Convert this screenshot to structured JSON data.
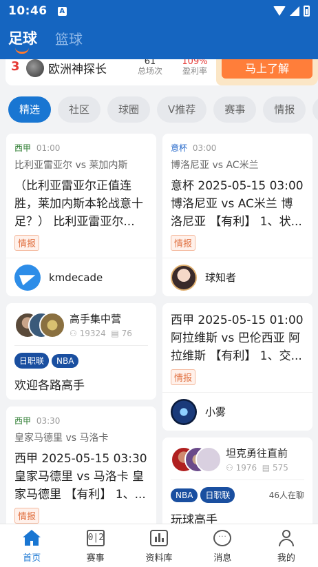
{
  "status": {
    "time": "10:46",
    "notif_glyph": "A"
  },
  "sport_tabs": [
    {
      "label": "足球",
      "active": true
    },
    {
      "label": "篮球",
      "active": false
    }
  ],
  "promo": {
    "rank": "3",
    "name": "欧洲神探长",
    "stats": [
      {
        "value": "61",
        "label": "总场次"
      },
      {
        "value": "109%",
        "label": "盈利率"
      }
    ],
    "button": "马上了解"
  },
  "chips": [
    "精选",
    "社区",
    "球圈",
    "V推荐",
    "赛事",
    "情报",
    "战"
  ],
  "feed_left": [
    {
      "type": "article",
      "league": "西甲",
      "league_color": "#2e7d32",
      "time": "01:00",
      "match": "比利亚雷亚尔 vs 莱加内斯",
      "title": "（比利亚雷亚尔正值连胜，莱加内斯本轮战意十足？） 比利亚雷亚尔...",
      "tag": "情报",
      "author": "kmdecade",
      "avatar_icon": "paper-plane-icon"
    },
    {
      "type": "group",
      "name": "高手集中营",
      "members": "19324",
      "posts": "76",
      "badges": [
        "日职联",
        "NBA"
      ],
      "online": "",
      "title": "欢迎各路高手"
    },
    {
      "type": "article",
      "league": "西甲",
      "league_color": "#2e7d32",
      "time": "03:30",
      "match": "皇家马德里 vs 马洛卡",
      "title": "西甲 2025-05-15 03:30 皇家马德里 vs 马洛卡 皇家马德里 【有利】 1、...",
      "tag": "情报"
    }
  ],
  "feed_right": [
    {
      "type": "article",
      "league": "意杯",
      "league_color": "#1e63c8",
      "time": "03:00",
      "match": "博洛尼亚 vs AC米兰",
      "title": "意杯 2025-05-15 03:00 博洛尼亚 vs AC米兰 博洛尼亚 【有利】 1、状...",
      "tag": "情报",
      "author": "球知者",
      "avatar_icon": "cartoon-avatar-icon"
    },
    {
      "type": "article_nometa",
      "title": "西甲 2025-05-15 01:00 阿拉维斯 vs 巴伦西亚 阿拉维斯 【有利】 1、交...",
      "tag": "情报",
      "author": "小雾",
      "avatar_icon": "car-avatar-icon"
    },
    {
      "type": "group",
      "name": "坦克勇往直前",
      "members": "1976",
      "posts": "575",
      "badges": [
        "NBA",
        "日职联"
      ],
      "online": "46人在聊",
      "title": "玩球高手"
    }
  ],
  "bottom_nav": [
    {
      "label": "首页",
      "icon": "home-icon",
      "active": true
    },
    {
      "label": "赛事",
      "icon": "scoreboard-icon",
      "glyph": "0|2",
      "active": false
    },
    {
      "label": "资料库",
      "icon": "chart-icon",
      "active": false
    },
    {
      "label": "消息",
      "icon": "message-icon",
      "glyph": "···",
      "active": false
    },
    {
      "label": "我的",
      "icon": "profile-icon",
      "active": false
    }
  ],
  "colors": {
    "brand": "#1565c0",
    "accent": "#1976d2",
    "orange": "#ff7e3a",
    "tag": "#e07040"
  }
}
